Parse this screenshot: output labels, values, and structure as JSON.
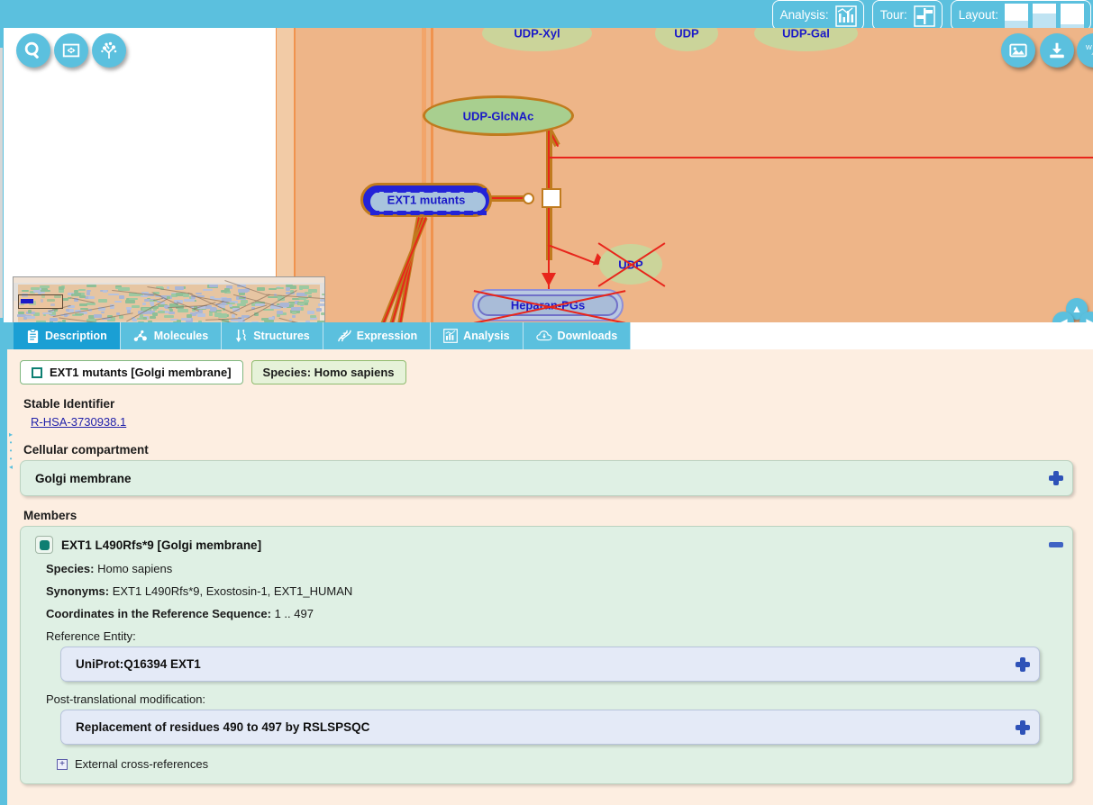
{
  "topbar": {
    "analysis_label": "Analysis:",
    "analysis_icon": "analysis-chart-icon",
    "tour_label": "Tour:",
    "tour_icon": "signpost-icon",
    "layout_label": "Layout:",
    "layout_options": [
      "layout-option-1",
      "layout-option-2",
      "layout-option-3"
    ],
    "accent_color": "#5bc0de"
  },
  "diagram": {
    "left_tools": [
      {
        "name": "search-icon",
        "title": "Search"
      },
      {
        "name": "fit-to-screen-icon",
        "title": "Fit to screen"
      },
      {
        "name": "pathway-overview-icon",
        "title": "Pathway overview"
      }
    ],
    "right_tools": [
      {
        "name": "export-image-icon",
        "title": "Export image"
      },
      {
        "name": "download-icon",
        "title": "Download"
      },
      {
        "name": "wiki-icon",
        "title": "Wiki"
      }
    ],
    "pad": {
      "up": "▲",
      "down": "▼",
      "left": "◀",
      "right": "▶"
    },
    "nodes": [
      {
        "id": "udp-xyl",
        "label": "UDP-Xyl",
        "kind": "chemical-faded"
      },
      {
        "id": "udp-top",
        "label": "UDP",
        "kind": "chemical-faded"
      },
      {
        "id": "udp-gal",
        "label": "UDP-Gal",
        "kind": "chemical-faded"
      },
      {
        "id": "udp-glcnac",
        "label": "UDP-GlcNAc",
        "kind": "chemical"
      },
      {
        "id": "ext1-mutants",
        "label": "EXT1 mutants",
        "kind": "protein-selected"
      },
      {
        "id": "heparan-pgs",
        "label": "Heparan-PGs",
        "kind": "complex-crossed"
      },
      {
        "id": "udp-product",
        "label": "UDP",
        "kind": "chemical-crossed"
      }
    ],
    "colors": {
      "compartment_fill": "#eeb588",
      "chemical_fill": "#a8cf8f",
      "chemical_border": "#c07b1e",
      "protein_fill": "#a8c4dd",
      "selection_blue": "#2323d8",
      "disease_red": "#e8251b",
      "node_text": "#1a19c8"
    },
    "bottom_nav": "▲ ●●● ▼"
  },
  "tabs": [
    {
      "label": "Description",
      "icon": "clipboard-icon",
      "active": true
    },
    {
      "label": "Molecules",
      "icon": "molecule-icon",
      "active": false
    },
    {
      "label": "Structures",
      "icon": "structures-icon",
      "active": false
    },
    {
      "label": "Expression",
      "icon": "dna-icon",
      "active": false
    },
    {
      "label": "Analysis",
      "icon": "bar-chart-icon",
      "active": false
    },
    {
      "label": "Downloads",
      "icon": "cloud-download-icon",
      "active": false
    }
  ],
  "detail": {
    "entity_chip": "EXT1 mutants [Golgi membrane]",
    "species_chip": "Species: Homo sapiens",
    "stable_identifier_title": "Stable Identifier",
    "stable_identifier_value": "R-HSA-3730938.1",
    "compartment_title": "Cellular compartment",
    "compartment_value": "Golgi membrane",
    "members_title": "Members",
    "member": {
      "name": "EXT1 L490Rfs*9 [Golgi membrane]",
      "species_key": "Species:",
      "species_value": "Homo sapiens",
      "synonyms_key": "Synonyms:",
      "synonyms_value": "EXT1 L490Rfs*9, Exostosin-1, EXT1_HUMAN",
      "coordinates_key": "Coordinates in the Reference Sequence:",
      "coordinates_value": "1 .. 497",
      "reference_entity_label": "Reference Entity:",
      "reference_entity_value": "UniProt:Q16394 EXT1",
      "ptm_label": "Post-translational modification:",
      "ptm_value": "Replacement of residues 490 to 497 by RSLSPSQC",
      "xref_label": "External cross-references",
      "xref_expander": "+"
    }
  }
}
